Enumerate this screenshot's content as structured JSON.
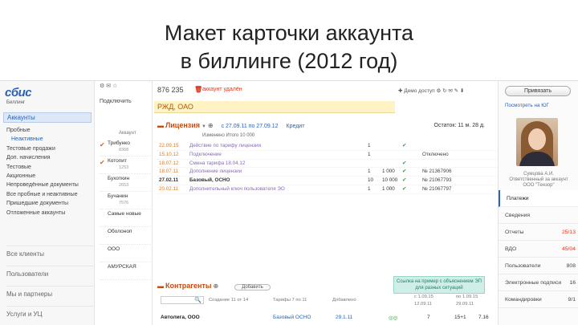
{
  "slide": {
    "title_line1": "Макет карточки аккаунта",
    "title_line2": "в биллинге (2012 год)"
  },
  "app": {
    "logo": "сбис",
    "logo_sub": "Биллинг"
  },
  "nav": {
    "active_section": "Аккаунты",
    "items": [
      {
        "label": "Пробные",
        "selected": false
      },
      {
        "label": "Неактивные",
        "selected": true
      },
      {
        "label": "Тестовые продажи",
        "selected": false
      },
      {
        "label": "Доп. начисления",
        "selected": false
      },
      {
        "label": "Тестовые",
        "selected": false
      },
      {
        "label": "Акционные",
        "selected": false
      },
      {
        "label": "Непроведённые документы",
        "selected": false
      },
      {
        "label": "Все пробные и неактивные",
        "selected": false
      },
      {
        "label": "Пришедшие документы",
        "selected": false
      },
      {
        "label": "Отложенные аккаунты",
        "selected": false
      }
    ],
    "groups": [
      "Все клиенты",
      "Пользователи",
      "Мы и партнеры",
      "Услуги и УЦ"
    ]
  },
  "midcol": {
    "tools": "⚙ ✉ ☆",
    "subscribe": "Подключить",
    "head": "Аккаунт",
    "rows": [
      {
        "name": "Трибунко",
        "num": "8368",
        "checked": true
      },
      {
        "name": "Котопит",
        "num": "1253",
        "checked": true
      },
      {
        "name": "Бухоткин",
        "num": "2653",
        "checked": false
      },
      {
        "name": "Бучанин",
        "num": "7576",
        "checked": false
      },
      {
        "name": "Самые новые",
        "num": "",
        "checked": false
      },
      {
        "name": "Оболоноп",
        "num": "",
        "checked": false
      },
      {
        "name": "ООО",
        "num": "",
        "checked": false
      },
      {
        "name": "АМУРСКАЯ",
        "num": "",
        "checked": false
      }
    ]
  },
  "account": {
    "number": "876 235",
    "deleted_icon": "trash-icon",
    "deleted_label": "аккаунт удалён",
    "top_right": "✚ Демо доступ  ⚙  ↻  ✉  ✎  ⬇",
    "org_name": "РЖД, ОАО"
  },
  "licenses": {
    "title": "Лицензия",
    "period_link": "с 27.09.11 по 27.09.12",
    "credit_link": "Кредит",
    "balance": "Остаток: 11 м. 28 д.",
    "header": "Изменено           Итого 10 000",
    "rows": [
      {
        "date": "22.09.15",
        "desc": "Действие по тарифу лицензии",
        "q1": "1",
        "q2": "",
        "chk": "✔",
        "num": "",
        "hl": false
      },
      {
        "date": "15.10.12",
        "desc": "Подключение",
        "q1": "1",
        "q2": "",
        "chk": "",
        "num": "Отключено",
        "hl": false
      },
      {
        "date": "18.07.12",
        "desc": "Смена тарифа 18.04.12",
        "q1": "",
        "q2": "",
        "chk": "✔",
        "num": "",
        "hl": false
      },
      {
        "date": "18.07.11",
        "desc": "Дополнение лицензии",
        "q1": "1",
        "q2": "1 000",
        "chk": "✔",
        "num": "№ 21367906",
        "hl": false
      },
      {
        "date": "27.02.11",
        "desc": "Базовый, ОСНО",
        "q1": "10",
        "q2": "10 000",
        "chk": "✔",
        "num": "№ 21067793",
        "hl": true
      },
      {
        "date": "20.02.11",
        "desc": "Дополнительный ключ пользователя ЭО",
        "q1": "1",
        "q2": "1 000",
        "chk": "✔",
        "num": "№ 21067797",
        "hl": false
      }
    ]
  },
  "callout": {
    "text": "Ссылка на пример с объяснением ЭП для разных ситуаций"
  },
  "contractors": {
    "title": "Контрагенты",
    "button": "Добавить",
    "head": {
      "created": "Создание 11 от 14",
      "tariff": "Тарифы 7 по 11",
      "added": "Добавлено",
      "c1": "с 1.09.15",
      "c2": "по 1.09.15",
      "c3": "12.09.11",
      "c4": "29.09.11"
    },
    "row": {
      "name": "Автолига, ООО",
      "tariff": "Базовый ОСНО",
      "added": "29.1.11",
      "v1": "7",
      "v2": "15+1",
      "v3": "7.16"
    }
  },
  "right": {
    "pay_button": "Привязать",
    "pay_link": "Посмотреть на ЮГ",
    "person_name": "Сумцова А.И.\nОтветственный за аккаунт\nООО \"Тензор\"",
    "items": [
      {
        "label": "Платежи",
        "value": "",
        "red": false,
        "selected": true
      },
      {
        "label": "Сведения",
        "value": "",
        "red": false,
        "selected": false
      },
      {
        "label": "Отчеты",
        "value": "25/13",
        "red": true,
        "selected": false
      },
      {
        "label": "ВДО",
        "value": "45/04",
        "red": true,
        "selected": false
      },
      {
        "label": "Пользователи",
        "value": "808",
        "red": false,
        "selected": false
      },
      {
        "label": "Электронные подписи",
        "value": "16",
        "red": false,
        "selected": false
      },
      {
        "label": "Командировки",
        "value": "9/1",
        "red": false,
        "selected": false
      }
    ]
  },
  "colors": {
    "accent": "#2a63b5",
    "warning": "#c84b12",
    "deleted": "#d9381e",
    "org_bar": "#fff2c4",
    "callout": "#cfeee7"
  }
}
